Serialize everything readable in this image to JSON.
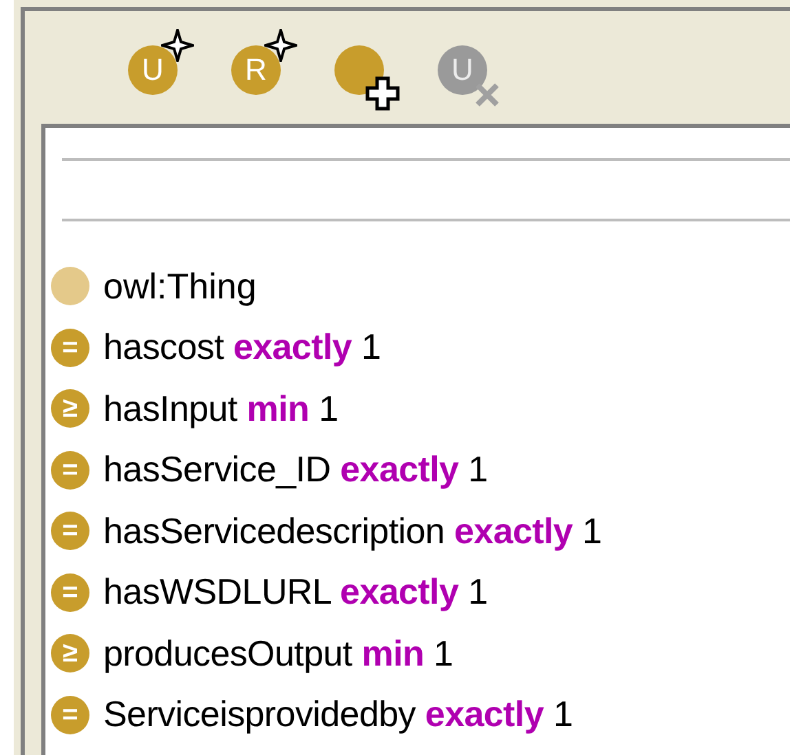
{
  "toolbar": [
    {
      "letter": "U",
      "kind": "star",
      "disabled": false
    },
    {
      "letter": "R",
      "kind": "star",
      "disabled": false
    },
    {
      "kind": "plus",
      "disabled": false
    },
    {
      "letter": "U",
      "kind": "cross",
      "disabled": true
    }
  ],
  "rows": [
    {
      "kind": "class",
      "name": "owl:Thing"
    },
    {
      "kind": "restriction",
      "symbol": "=",
      "property": "hascost",
      "quantifier": "exactly",
      "cardinality": "1"
    },
    {
      "kind": "restriction",
      "symbol": "≥",
      "property": "hasInput",
      "quantifier": "min",
      "cardinality": "1"
    },
    {
      "kind": "restriction",
      "symbol": "=",
      "property": "hasService_ID",
      "quantifier": "exactly",
      "cardinality": "1"
    },
    {
      "kind": "restriction",
      "symbol": "=",
      "property": "hasServicedescription",
      "quantifier": "exactly",
      "cardinality": "1"
    },
    {
      "kind": "restriction",
      "symbol": "=",
      "property": "hasWSDLURL",
      "quantifier": "exactly",
      "cardinality": "1"
    },
    {
      "kind": "restriction",
      "symbol": "≥",
      "property": "producesOutput",
      "quantifier": "min",
      "cardinality": "1"
    },
    {
      "kind": "restriction",
      "symbol": "=",
      "property": "Serviceisprovidedby",
      "quantifier": "exactly",
      "cardinality": "1"
    }
  ]
}
